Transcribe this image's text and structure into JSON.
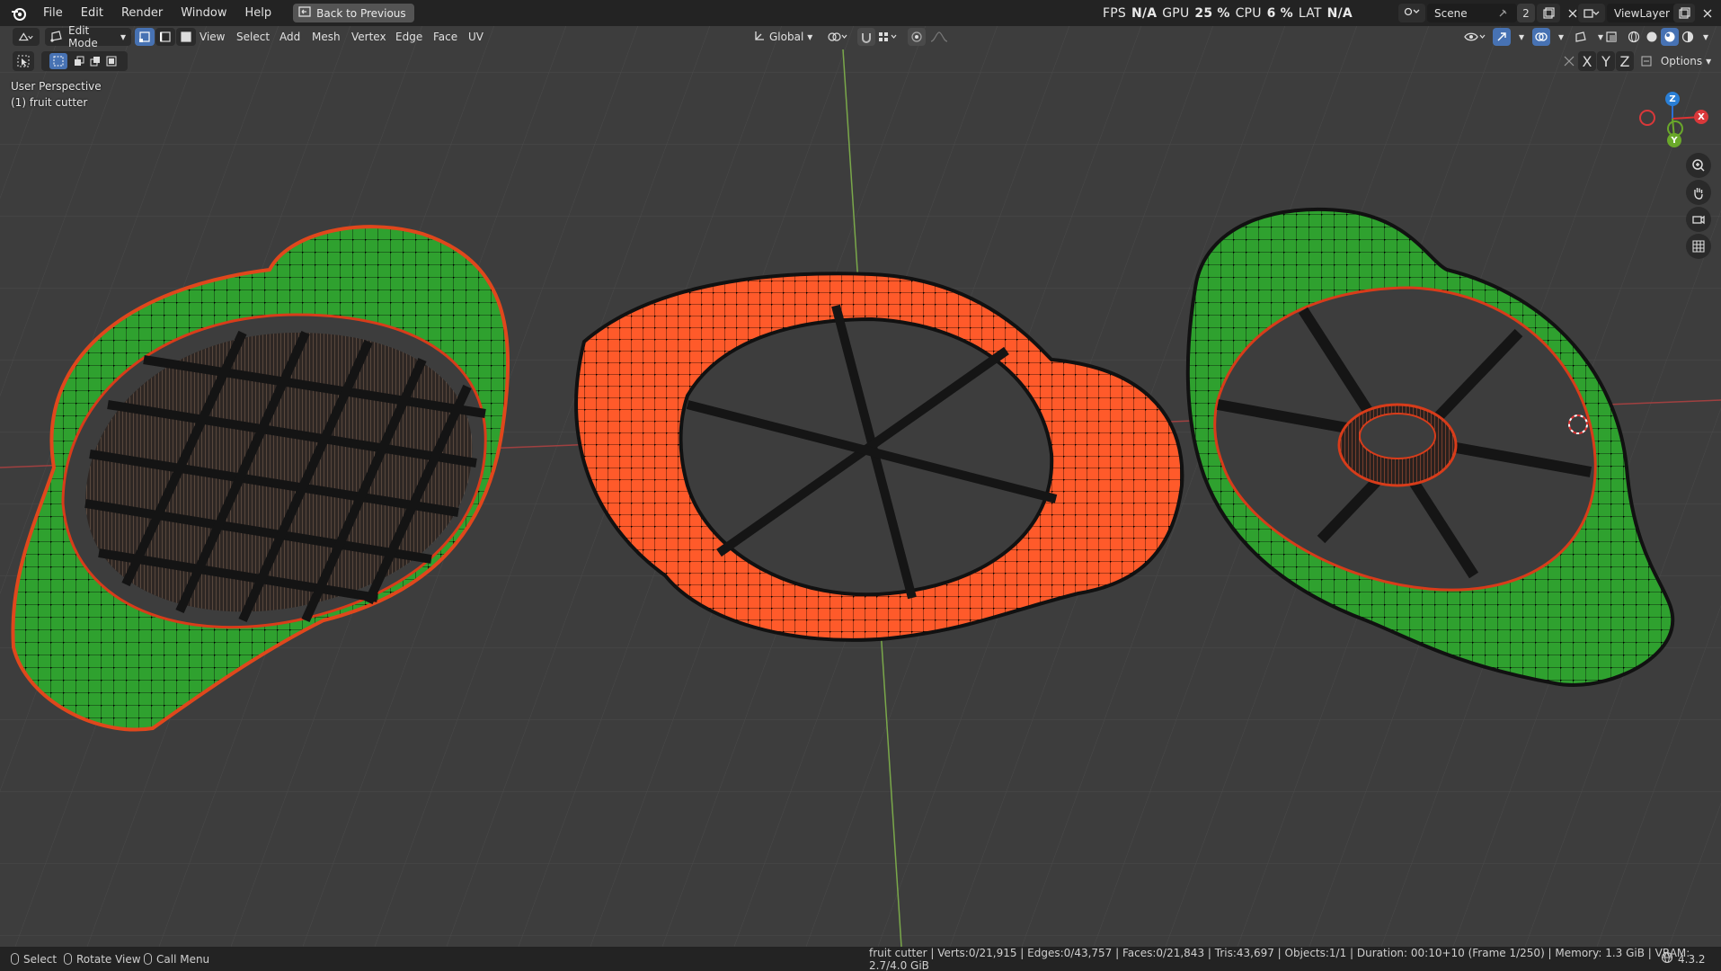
{
  "menubar": {
    "items": [
      "File",
      "Edit",
      "Render",
      "Window",
      "Help"
    ],
    "back_button": "Back to Previous"
  },
  "stats": {
    "fps_label": "FPS",
    "fps_value": "N/A",
    "gpu_label": "GPU",
    "gpu_value": "25 %",
    "cpu_label": "CPU",
    "cpu_value": "6 %",
    "lat_label": "LAT",
    "lat_value": "N/A"
  },
  "scene": {
    "name": "Scene",
    "count": "2",
    "view_layer": "ViewLayer"
  },
  "header": {
    "mode": "Edit Mode",
    "menus": [
      "View",
      "Select",
      "Add",
      "Mesh",
      "Vertex",
      "Edge",
      "Face",
      "UV"
    ],
    "orientation": "Global",
    "axes": [
      "X",
      "Y",
      "Z"
    ],
    "options": "Options"
  },
  "viewport": {
    "perspective": "User Perspective",
    "object": "(1) fruit cutter",
    "gizmo": {
      "z": "Z",
      "x": "X",
      "y": "Y"
    }
  },
  "statusbar": {
    "select": "Select",
    "rotate": "Rotate View",
    "call_menu": "Call Menu",
    "info": "fruit cutter | Verts:0/21,915 | Edges:0/43,757 | Faces:0/21,843 | Tris:43,697 | Objects:1/1 | Duration: 00:10+10 (Frame 1/250) | Memory: 1.3 GiB | VRAM: 2.7/4.0 GiB",
    "version": "4.3.2"
  },
  "colors": {
    "selected_mesh": "#ff5a2a",
    "unselected_mesh": "#2aa32a",
    "grid_bg": "#3d3d3d",
    "x_axis": "#b04040",
    "y_axis": "#7aa84a",
    "accent": "#4772b3"
  },
  "icons": [
    "blender-logo-icon",
    "back-icon",
    "editor-type-icon",
    "edit-mode-icon",
    "vertex-select-icon",
    "edge-select-icon",
    "face-select-icon",
    "transform-orientation-icon",
    "pivot-icon",
    "snap-icon",
    "proportional-edit-icon",
    "visibility-icon",
    "gizmo-icon",
    "overlay-icon",
    "xray-icon",
    "shading-solid-icon",
    "zoom-icon",
    "pan-hand-icon",
    "camera-icon",
    "grid-icon",
    "select-box-icon"
  ]
}
